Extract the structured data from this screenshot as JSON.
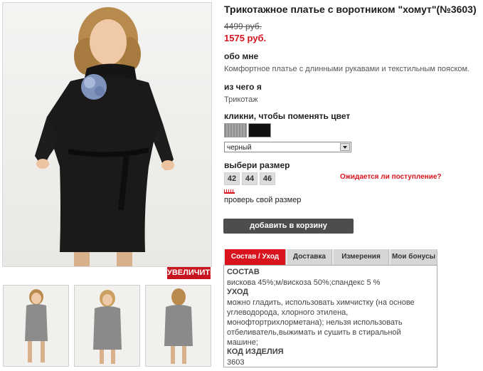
{
  "product": {
    "title": "Трикотажное платье с воротником \"хомут\"(№3603)",
    "old_price": "4499 руб.",
    "new_price": "1575 руб."
  },
  "about": {
    "heading": "обо мне",
    "text": "Комфортное платье с длинными рукавами и текстильным пояском."
  },
  "material": {
    "heading": "из чего я",
    "text": "Трикотаж"
  },
  "color": {
    "heading": "кликни, чтобы поменять цвет",
    "selected": "черный",
    "swatch_colors": [
      "#9a9a9a",
      "#111111"
    ]
  },
  "size": {
    "heading": "выбери размер",
    "options": [
      "42",
      "44",
      "46"
    ],
    "awaiting": "Ожидается ли поступление?",
    "check_link": "проверь свой размер"
  },
  "zoom_label": "УВЕЛИЧИТЬ",
  "cart_label": "добавить в корзину",
  "tabs": [
    "Состав / Уход",
    "Доставка",
    "Измерения",
    "Мои бонусы"
  ],
  "details": {
    "composition_heading": "СОСТАВ",
    "composition": "вискова 45%;м/вискоза 50%;спандекс 5 %",
    "care_heading": "УХОД",
    "care_lines": [
      "можно гладить, использовать химчистку (на основе",
      "углеводорода, хлорного этилена,",
      "монофтортрихлорметана); нельзя использовать",
      "отбеливатель,выжимать и сушить в стиральной",
      "машине;"
    ],
    "code_heading": "КОД ИЗДЕЛИЯ",
    "code": "3603"
  },
  "accent_color": "#d9141e"
}
